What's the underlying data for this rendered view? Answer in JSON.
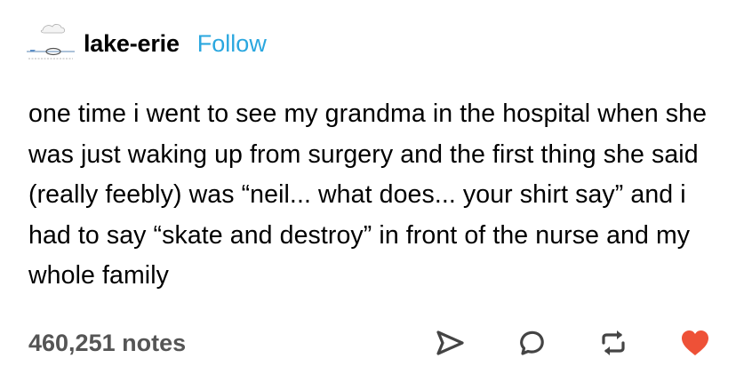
{
  "post": {
    "author": {
      "name": "lake-erie",
      "avatar_icon": "lake-drawing-avatar",
      "follow_label": "Follow"
    },
    "text": "one time i went to see my grandma in the hospital when she was just waking up from surgery and the first thing she said (really feebly) was “neil... what does... your shirt say” and i had to say “skate and destroy” in front of the nurse and my whole family",
    "notes_label": "460,251 notes",
    "actions": [
      {
        "name": "share",
        "icon": "paper-plane-icon"
      },
      {
        "name": "reply",
        "icon": "speech-bubble-icon"
      },
      {
        "name": "reblog",
        "icon": "reblog-arrows-icon"
      },
      {
        "name": "like",
        "icon": "heart-icon"
      }
    ]
  },
  "colors": {
    "text": "#000000",
    "follow": "#2aa7df",
    "notes": "#555555",
    "icons": "#444444",
    "like": "#ee5137"
  }
}
